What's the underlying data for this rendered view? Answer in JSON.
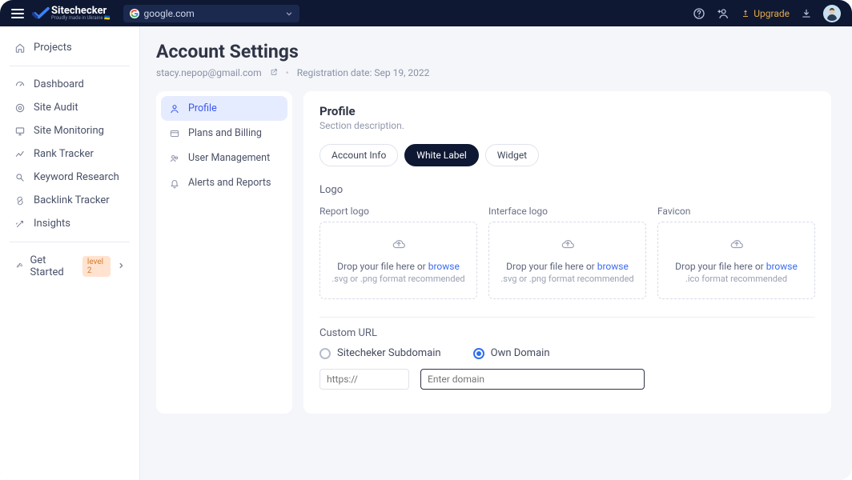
{
  "header": {
    "brand_name": "Sitechecker",
    "brand_tagline": "Proudly made in Ukraine 🇺🇦",
    "url_bar_text": "google.com",
    "upgrade_label": "Upgrade"
  },
  "sidebar": {
    "projects_label": "Projects",
    "items": [
      "Dashboard",
      "Site Audit",
      "Site Monitoring",
      "Rank Tracker",
      "Keyword Research",
      "Backlink Tracker",
      "Insights"
    ],
    "get_started_label": "Get Started",
    "get_started_badge": "level 2"
  },
  "page": {
    "title": "Account Settings",
    "email": "stacy.nepop@gmail.com",
    "reg_prefix": "Registration date: ",
    "reg_date": "Sep 19, 2022"
  },
  "settings_nav": {
    "items": [
      "Profile",
      "Plans and Billing",
      "User Management",
      "Alerts and Reports"
    ],
    "active_index": 0
  },
  "card": {
    "title": "Profile",
    "subtitle": "Section description.",
    "tabs": [
      "Account Info",
      "White Label",
      "Widget"
    ],
    "active_tab": 1,
    "logo_section_label": "Logo",
    "uploads": [
      {
        "caption": "Report logo",
        "drop_text": "Drop your file here or ",
        "browse": "browse",
        "hint": ".svg or .png format recommended"
      },
      {
        "caption": "Interface logo",
        "drop_text": "Drop your file here or ",
        "browse": "browse",
        "hint": ".svg or .png format recommended"
      },
      {
        "caption": "Favicon",
        "drop_text": "Drop your file here or ",
        "browse": "browse",
        "hint": ".ico format recommended"
      }
    ],
    "custom_url_label": "Custom URL",
    "radio_subdomain": "Sitecheker Subdomain",
    "radio_own": "Own Domain",
    "prefix_placeholder": "https://",
    "domain_placeholder": "Enter domain"
  }
}
